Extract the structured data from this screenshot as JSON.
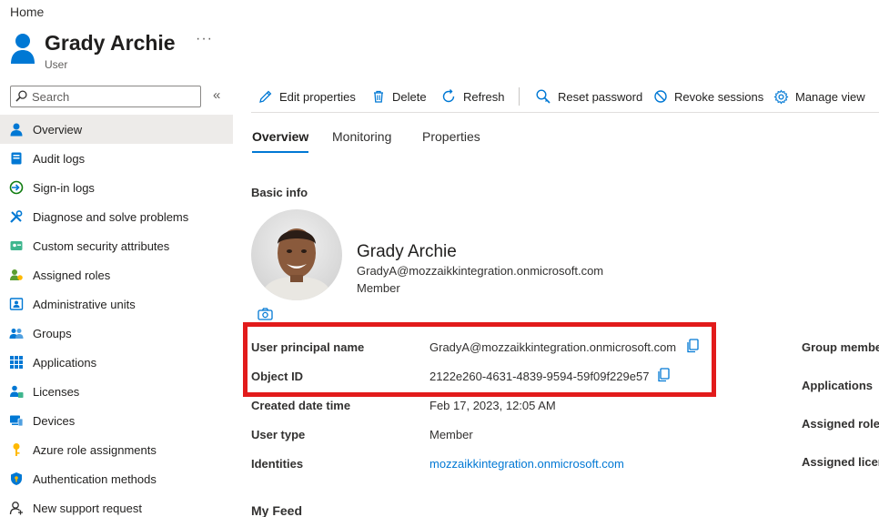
{
  "breadcrumb": "Home",
  "header": {
    "title": "Grady Archie",
    "subtitle": "User",
    "more": "···"
  },
  "sidebar": {
    "search_placeholder": "Search",
    "collapse": "«",
    "items": [
      {
        "label": "Overview",
        "icon": "user-icon",
        "active": true
      },
      {
        "label": "Audit logs",
        "icon": "audit-log-icon"
      },
      {
        "label": "Sign-in logs",
        "icon": "sign-in-icon"
      },
      {
        "label": "Diagnose and solve problems",
        "icon": "wrench-icon"
      },
      {
        "label": "Custom security attributes",
        "icon": "security-attributes-icon"
      },
      {
        "label": "Assigned roles",
        "icon": "roles-icon"
      },
      {
        "label": "Administrative units",
        "icon": "admin-units-icon"
      },
      {
        "label": "Groups",
        "icon": "groups-icon"
      },
      {
        "label": "Applications",
        "icon": "apps-grid-icon"
      },
      {
        "label": "Licenses",
        "icon": "licenses-icon"
      },
      {
        "label": "Devices",
        "icon": "devices-icon"
      },
      {
        "label": "Azure role assignments",
        "icon": "key-icon"
      },
      {
        "label": "Authentication methods",
        "icon": "shield-icon"
      },
      {
        "label": "New support request",
        "icon": "support-icon"
      }
    ]
  },
  "toolbar": {
    "edit": "Edit properties",
    "delete": "Delete",
    "refresh": "Refresh",
    "reset_password": "Reset password",
    "revoke_sessions": "Revoke sessions",
    "manage_view": "Manage view"
  },
  "tabs": [
    "Overview",
    "Monitoring",
    "Properties"
  ],
  "basic_info": {
    "title": "Basic info",
    "name": "Grady Archie",
    "email": "GradyA@mozzaikkintegration.onmicrosoft.com",
    "member_type": "Member"
  },
  "properties": [
    {
      "label": "User principal name",
      "value": "GradyA@mozzaikkintegration.onmicrosoft.com"
    },
    {
      "label": "Object ID",
      "value": "2122e260-4631-4839-9594-59f09f229e57"
    },
    {
      "label": "Created date time",
      "value": "Feb 17, 2023, 12:05 AM"
    },
    {
      "label": "User type",
      "value": "Member"
    },
    {
      "label": "Identities",
      "value": "mozzaikkintegration.onmicrosoft.com"
    }
  ],
  "right_column": [
    "Group membe",
    "Applications",
    "Assigned roles",
    "Assigned licen"
  ],
  "feed_title": "My Feed",
  "colors": {
    "accent": "#0078d4",
    "highlight": "#e21b1b",
    "active_nav": "#edebe9"
  }
}
